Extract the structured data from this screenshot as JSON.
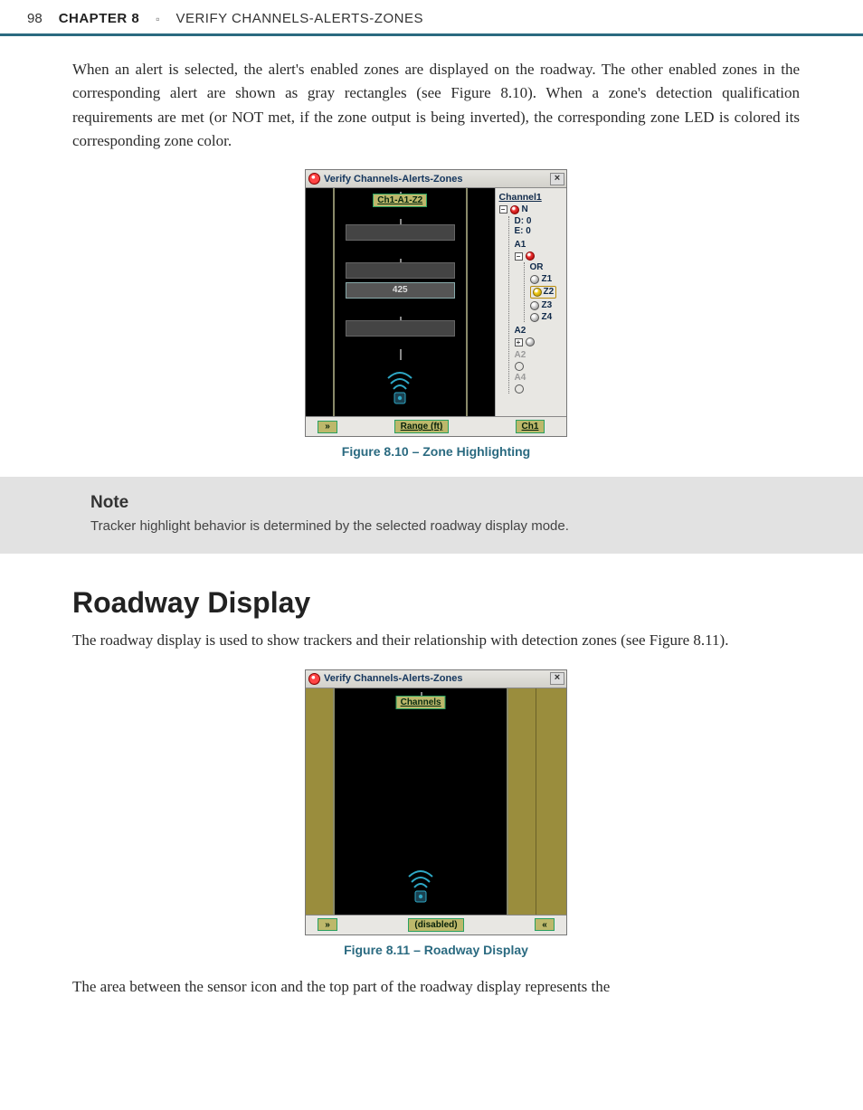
{
  "header": {
    "page_number": "98",
    "chapter_label": "CHAPTER 8",
    "separator": "▫",
    "chapter_title": "VERIFY CHANNELS-ALERTS-ZONES"
  },
  "para1": "When an alert is selected, the alert's enabled zones are displayed on the roadway. The other enabled zones in the corresponding alert are shown as gray rectangles (see Figure 8.10). When a zone's detection qualification requirements are met (or NOT met, if the zone output is being inverted), the corresponding zone LED is colored its corresponding zone color.",
  "fig810": {
    "title": "Verify Channels-Alerts-Zones",
    "close": "×",
    "chip_label": "Ch1-A1-Z2",
    "range_value": "425",
    "tree": {
      "head": "Channel1",
      "nflag": "N",
      "d": "D: 0",
      "e": "E: 0",
      "a1": "A1",
      "or": "OR",
      "z1": "Z1",
      "z2": "Z2",
      "z3": "Z3",
      "z4": "Z4",
      "a2": "A2",
      "a2dim": "A2",
      "a4dim": "A4"
    },
    "footer": {
      "expand": "»",
      "range": "Range (ft)",
      "ch": "Ch1"
    },
    "caption": "Figure 8.10 – Zone Highlighting"
  },
  "note": {
    "title": "Note",
    "body": "Tracker highlight behavior is determined by the selected roadway display mode."
  },
  "section_heading": "Roadway Display",
  "para2": "The roadway display is used to show trackers and their relationship with detection zones (see Figure 8.11).",
  "fig811": {
    "title": "Verify Channels-Alerts-Zones",
    "close": "×",
    "chip_label": "Channels",
    "footer": {
      "expand": "»",
      "disabled": "(disabled)",
      "collapse": "«"
    },
    "caption": "Figure 8.11 – Roadway Display"
  },
  "para3": "The area between the sensor icon and the top part of the roadway display represents the"
}
